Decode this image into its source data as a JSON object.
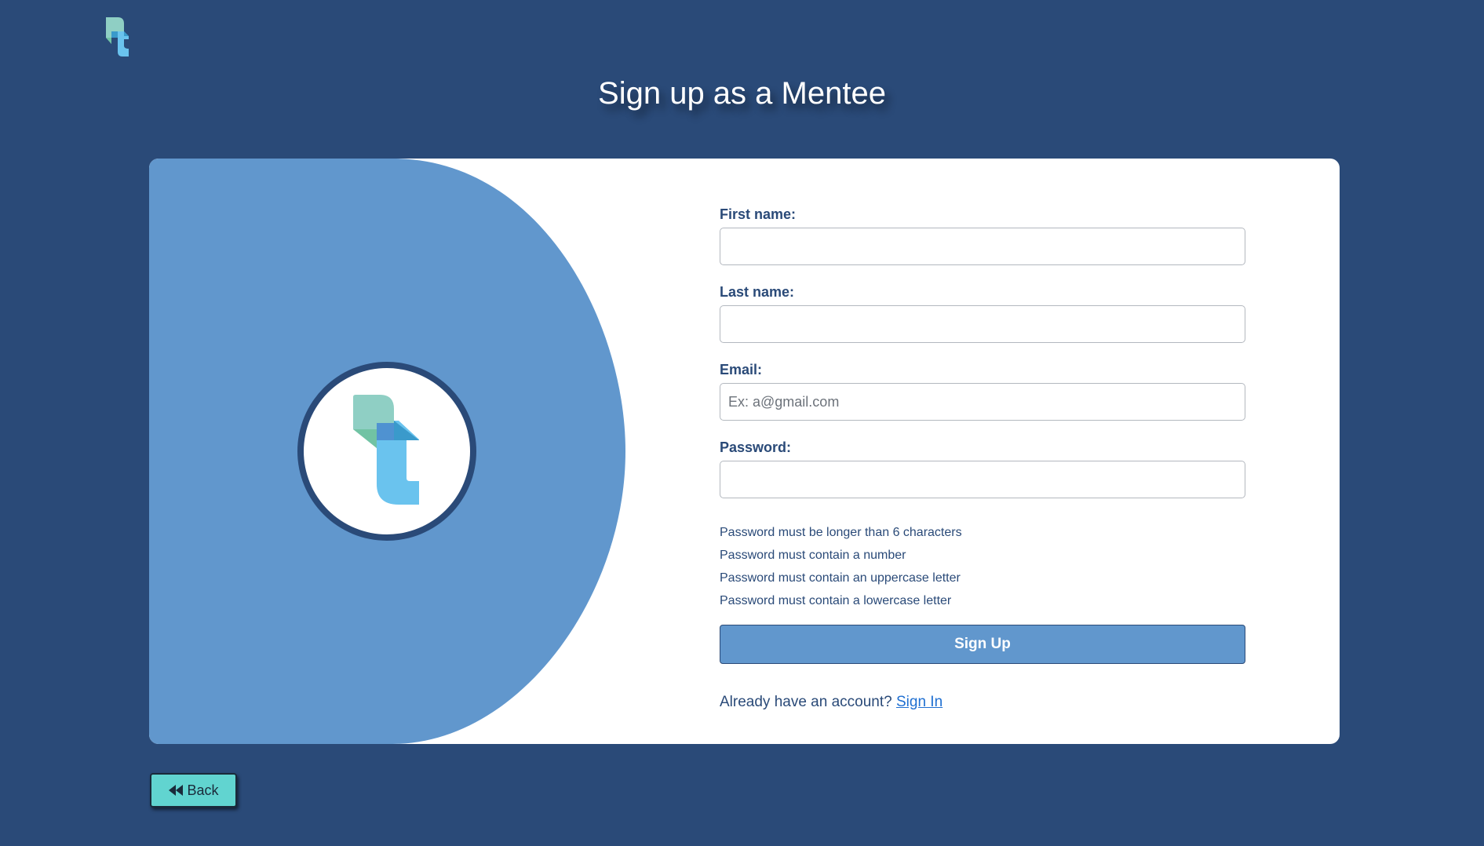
{
  "page": {
    "title": "Sign up as a Mentee"
  },
  "brand": {
    "logo_icon": "brand-logo-icon",
    "colors": {
      "background": "#2a4a78",
      "panel": "#6197cd",
      "logo_teal": "#8fcfc4",
      "logo_green": "#71c3a4",
      "logo_blue": "#6ac3ee",
      "logo_darkblue": "#3a9acb",
      "accent_button": "#61d4d0"
    }
  },
  "form": {
    "first_name": {
      "label": "First name:",
      "value": "",
      "placeholder": ""
    },
    "last_name": {
      "label": "Last name:",
      "value": "",
      "placeholder": ""
    },
    "email": {
      "label": "Email:",
      "value": "",
      "placeholder": "Ex: a@gmail.com"
    },
    "password": {
      "label": "Password:",
      "value": "",
      "placeholder": ""
    },
    "password_rules": [
      "Password must be longer than 6 characters",
      "Password must contain a number",
      "Password must contain an uppercase letter",
      "Password must contain a lowercase letter"
    ],
    "submit_label": "Sign Up",
    "signin_prompt": "Already have an account?",
    "signin_link": "Sign In"
  },
  "footer": {
    "back_label": "Back",
    "back_icon": "rewind-icon"
  }
}
